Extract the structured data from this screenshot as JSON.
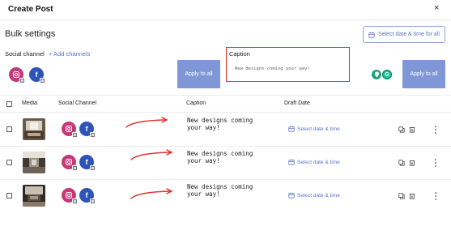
{
  "dialog": {
    "title": "Create Post",
    "close_glyph": "×"
  },
  "bulk": {
    "title": "Bulk settings",
    "date_all_label": "Select date & time for all",
    "social_label": "Social channel",
    "add_channels": "+ Add channels",
    "apply_left": "Apply to all",
    "apply_right": "Apply to all",
    "caption_label": "Caption",
    "caption_value": "New designs coming your way!"
  },
  "table": {
    "columns": [
      "Media",
      "Social Channel",
      "Caption",
      "Draft Date"
    ],
    "rows": [
      {
        "caption_line1": "New designs coming",
        "caption_line2": "your way!",
        "date_label": "Select date & time"
      },
      {
        "caption_line1": "New designs coming",
        "caption_line2": "your way!",
        "date_label": "Select date & time"
      },
      {
        "caption_line1": "New designs coming",
        "caption_line2": "your way!",
        "date_label": "Select date & time"
      }
    ]
  },
  "colors": {
    "accent": "#5b74c8",
    "apply_button": "#7f97d6",
    "highlight": "#e0312f",
    "instagram": "#c43a78",
    "facebook": "#2f54b8"
  },
  "icons": [
    "instagram-icon",
    "facebook-icon",
    "calendar-icon",
    "copy-icon",
    "trash-icon",
    "kebab-menu-icon",
    "grammarly-icon",
    "map-pin-icon",
    "red-arrow-annotation"
  ]
}
